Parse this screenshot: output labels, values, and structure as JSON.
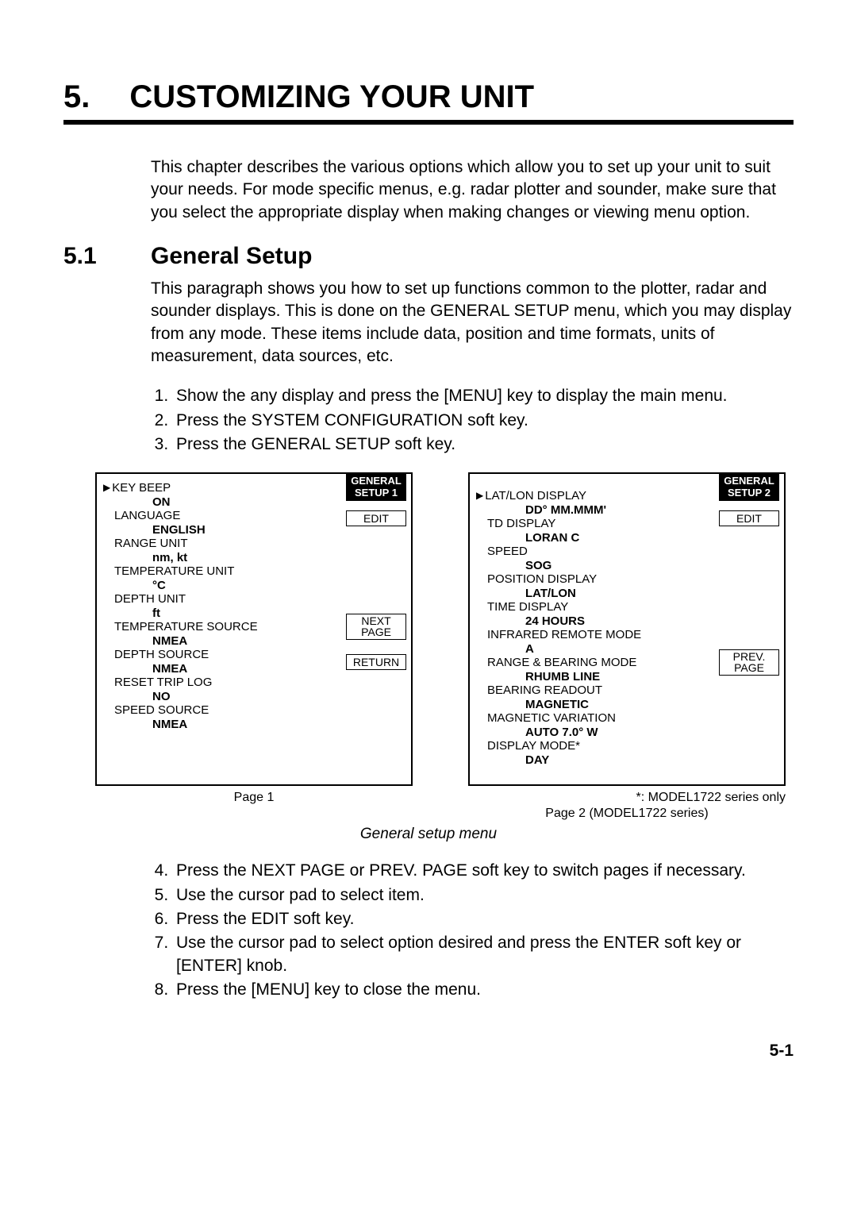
{
  "chapter": {
    "num": "5.",
    "title": "CUSTOMIZING YOUR UNIT"
  },
  "intro": "This chapter describes the various options which allow you to set up your unit to suit your needs. For mode specific menus, e.g. radar plotter and sounder, make sure that you select the appropriate display when making changes or viewing menu option.",
  "section": {
    "num": "5.1",
    "title": "General Setup"
  },
  "section_body": "This paragraph shows you how to set up functions common to the plotter, radar and sounder displays. This is done on the GENERAL SETUP menu, which you may display from any mode. These items include data, position and time formats, units of measurement, data sources, etc.",
  "steps_a": [
    "Show the any display and press the [MENU] key to display the main menu.",
    "Press the SYSTEM CONFIGURATION soft key.",
    "Press the GENERAL SETUP soft key."
  ],
  "panel1": {
    "title_l1": "GENERAL",
    "title_l2": "SETUP 1",
    "softkeys": {
      "edit": "EDIT",
      "next_l1": "NEXT",
      "next_l2": "PAGE",
      "return": "RETURN"
    },
    "items": [
      {
        "label": "KEY BEEP",
        "value": "ON",
        "cursor": true
      },
      {
        "label": "LANGUAGE",
        "value": "ENGLISH"
      },
      {
        "label": "RANGE UNIT",
        "value": "nm, kt"
      },
      {
        "label": "TEMPERATURE UNIT",
        "value": "°C"
      },
      {
        "label": "DEPTH UNIT",
        "value": "ft"
      },
      {
        "label": "TEMPERATURE SOURCE",
        "value": "NMEA"
      },
      {
        "label": "DEPTH SOURCE",
        "value": "NMEA"
      },
      {
        "label": "RESET TRIP LOG",
        "value": "NO"
      },
      {
        "label": "SPEED SOURCE",
        "value": "NMEA"
      }
    ]
  },
  "panel2": {
    "title_l1": "GENERAL",
    "title_l2": "SETUP 2",
    "softkeys": {
      "edit": "EDIT",
      "prev_l1": "PREV.",
      "prev_l2": "PAGE"
    },
    "items": [
      {
        "label": "LAT/LON DISPLAY",
        "value": "DD° MM.MMM'",
        "cursor": true
      },
      {
        "label": "TD DISPLAY",
        "value": "LORAN C"
      },
      {
        "label": "SPEED",
        "value": "SOG"
      },
      {
        "label": "POSITION DISPLAY",
        "value": "LAT/LON"
      },
      {
        "label": "TIME DISPLAY",
        "value": "24 HOURS"
      },
      {
        "label": "INFRARED REMOTE MODE",
        "value": "A"
      },
      {
        "label": "RANGE & BEARING MODE",
        "value": "RHUMB LINE"
      },
      {
        "label": "BEARING READOUT",
        "value": "MAGNETIC"
      },
      {
        "label": "MAGNETIC VARIATION",
        "value": "AUTO   7.0° W"
      },
      {
        "label": "DISPLAY MODE*",
        "value": "DAY"
      }
    ]
  },
  "captions": {
    "page1": "Page 1",
    "note": "*: MODEL1722 series only",
    "page2": "Page 2 (MODEL1722 series)",
    "figure": "General setup menu"
  },
  "steps_b": [
    "Press the NEXT PAGE or PREV. PAGE soft key to switch pages if necessary.",
    "Use the cursor pad to select item.",
    "Press the EDIT soft key.",
    "Use the cursor pad to select option desired and press the ENTER soft key or [ENTER] knob.",
    "Press the [MENU] key to close the menu."
  ],
  "page_number": "5-1"
}
